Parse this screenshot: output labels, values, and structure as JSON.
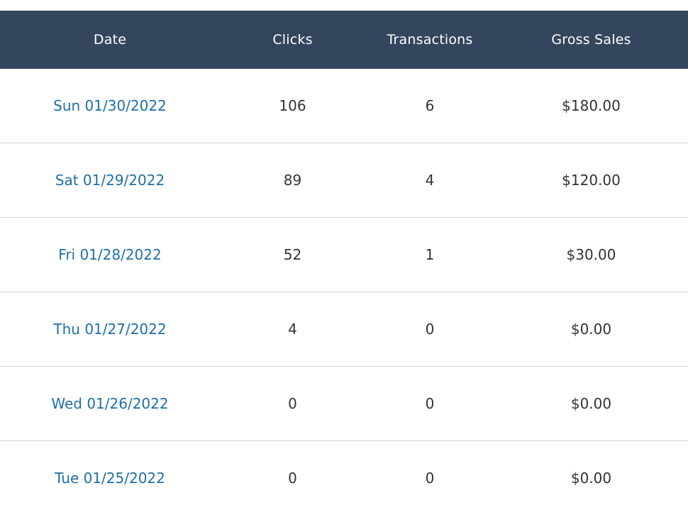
{
  "table": {
    "headers": {
      "date": "Date",
      "clicks": "Clicks",
      "transactions": "Transactions",
      "gross_sales": "Gross Sales"
    },
    "rows": [
      {
        "date": "Sun 01/30/2022",
        "clicks": "106",
        "transactions": "6",
        "gross_sales": "$180.00"
      },
      {
        "date": "Sat 01/29/2022",
        "clicks": "89",
        "transactions": "4",
        "gross_sales": "$120.00"
      },
      {
        "date": "Fri 01/28/2022",
        "clicks": "52",
        "transactions": "1",
        "gross_sales": "$30.00"
      },
      {
        "date": "Thu 01/27/2022",
        "clicks": "4",
        "transactions": "0",
        "gross_sales": "$0.00"
      },
      {
        "date": "Wed 01/26/2022",
        "clicks": "0",
        "transactions": "0",
        "gross_sales": "$0.00"
      },
      {
        "date": "Tue 01/25/2022",
        "clicks": "0",
        "transactions": "0",
        "gross_sales": "$0.00"
      }
    ]
  },
  "colors": {
    "header_bg": "#34465d",
    "link": "#1e6fa6",
    "text": "#333333",
    "row_border": "#d4d4d4"
  }
}
